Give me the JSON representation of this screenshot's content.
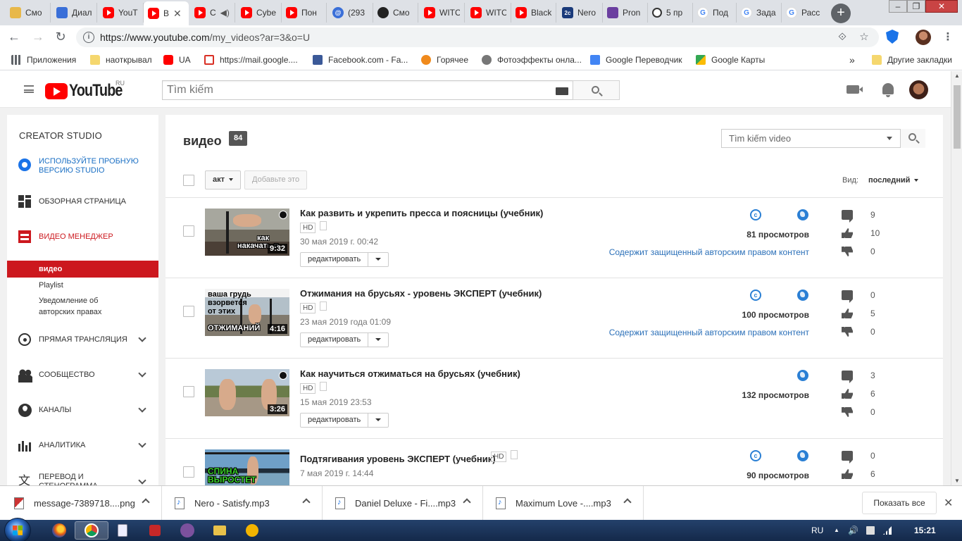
{
  "browser": {
    "tabs": [
      {
        "label": "Смо",
        "icon": "yellow-icon"
      },
      {
        "label": "Диал",
        "icon": "dialog-icon"
      },
      {
        "label": "YouT",
        "icon": "youtube-icon"
      },
      {
        "label": "В",
        "icon": "youtube-icon",
        "active": true
      },
      {
        "label": "С",
        "icon": "youtube-icon"
      },
      {
        "label": "Cybe",
        "icon": "youtube-icon"
      },
      {
        "label": "Пон",
        "icon": "youtube-icon"
      },
      {
        "label": "(293",
        "icon": "at-icon"
      },
      {
        "label": "Смо",
        "icon": "dark-icon"
      },
      {
        "label": "WITC",
        "icon": "youtube-icon"
      },
      {
        "label": "WITC",
        "icon": "youtube-icon"
      },
      {
        "label": "Black",
        "icon": "youtube-icon"
      },
      {
        "label": "Nero",
        "icon": "2c-icon"
      },
      {
        "label": "Pron",
        "icon": "purple-icon"
      },
      {
        "label": "5 пр",
        "icon": "ring-icon"
      },
      {
        "label": "Под",
        "icon": "google-icon"
      },
      {
        "label": "Зада",
        "icon": "google-icon"
      },
      {
        "label": "Расс",
        "icon": "google-icon"
      }
    ],
    "url_prefix": "https://www.youtube.com",
    "url_path": "/my_videos?ar=3&o=U",
    "bookmarks": [
      {
        "label": "Приложения",
        "icon": "apps"
      },
      {
        "label": "наоткрывал",
        "icon": "folder"
      },
      {
        "label": "UA",
        "icon": "yt"
      },
      {
        "label": "https://mail.google....",
        "icon": "mail"
      },
      {
        "label": "Facebook.com - Fa...",
        "icon": "fb"
      },
      {
        "label": "Горячее",
        "icon": "orange"
      },
      {
        "label": "Фотоэффекты онла...",
        "icon": "globe"
      },
      {
        "label": "Google Переводчик",
        "icon": "gt"
      },
      {
        "label": "Google Карты",
        "icon": "maps"
      }
    ],
    "bookmarks_more": "»",
    "other_bookmarks": "Другие закладки"
  },
  "youtube": {
    "logo_text": "YouTube",
    "region": "RU",
    "search_placeholder": "Tìm kiếm"
  },
  "sidebar": {
    "title": "CREATOR STUDIO",
    "try_studio": "ИСПОЛЬЗУЙТЕ ПРОБНУЮ ВЕРСИЮ STUDIO",
    "dashboard": "ОБЗОРНАЯ СТРАНИЦА",
    "video_manager": "ВИДЕО МЕНЕДЖЕР",
    "videos": "видео",
    "playlist": "Playlist",
    "copyright_notices": "Уведомление об авторских правах",
    "live": "ПРЯМАЯ ТРАНСЛЯЦИЯ",
    "community": "СООБЩЕСТВО",
    "channels": "КАНАЛЫ",
    "analytics": "АНАЛИТИКА",
    "translations": "ПЕРЕВОД И СТЕНОГРАММА"
  },
  "main": {
    "title": "видео",
    "count": "84",
    "search_placeholder": "Tìm kiếm video",
    "actions_label": "акт",
    "add_to_label": "Добавьте это",
    "view_label": "Вид:",
    "view_value": "последний",
    "edit_label": "редактировать",
    "hd_label": "HD"
  },
  "videos": [
    {
      "title": "Как развить и укрепить пресса и поясницы (учебник)",
      "date": "30 мая 2019 г. 00:42",
      "duration": "9:32",
      "thumb_text": [
        "как",
        "накачать п"
      ],
      "views": "81 просмотров",
      "claim": "Содержит защищенный авторским правом контент",
      "copyright": true,
      "comments": "9",
      "likes": "10",
      "dislikes": "0"
    },
    {
      "title": "Отжимания на брусьях - уровень ЭКСПЕРТ (учебник)",
      "date": "23 мая 2019 года 01:09",
      "duration": "4:16",
      "thumb_text": [
        "ваша грудь",
        "взорвется",
        "от этих",
        "ОТЖИМАНИЙ"
      ],
      "views": "100 просмотров",
      "claim": "Содержит защищенный авторским правом контент",
      "copyright": true,
      "comments": "0",
      "likes": "5",
      "dislikes": "0"
    },
    {
      "title": "Как научиться отжиматься на брусьях (учебник)",
      "date": "15 мая 2019 23:53",
      "duration": "3:26",
      "thumb_text": [],
      "views": "132 просмотров",
      "claim": "",
      "copyright": false,
      "comments": "3",
      "likes": "6",
      "dislikes": "0"
    },
    {
      "title": "Подтягивания уровень ЭКСПЕРТ (учебник)",
      "date": "7 мая 2019 г. 14:44",
      "duration": "",
      "thumb_text": [
        "СПИНА",
        "ВЫРОСТЕТ"
      ],
      "views": "90 просмотров",
      "claim": "",
      "copyright": true,
      "comments": "0",
      "likes": "6",
      "dislikes": ""
    }
  ],
  "downloads": [
    {
      "name": "message-7389718....png",
      "type": "png"
    },
    {
      "name": "Nero - Satisfy.mp3",
      "type": "mp3"
    },
    {
      "name": "Daniel Deluxe - Fi....mp3",
      "type": "mp3"
    },
    {
      "name": "Maximum Love -....mp3",
      "type": "mp3"
    }
  ],
  "downloads_show_all": "Показать все",
  "taskbar": {
    "lang": "RU",
    "time": "15:21"
  }
}
